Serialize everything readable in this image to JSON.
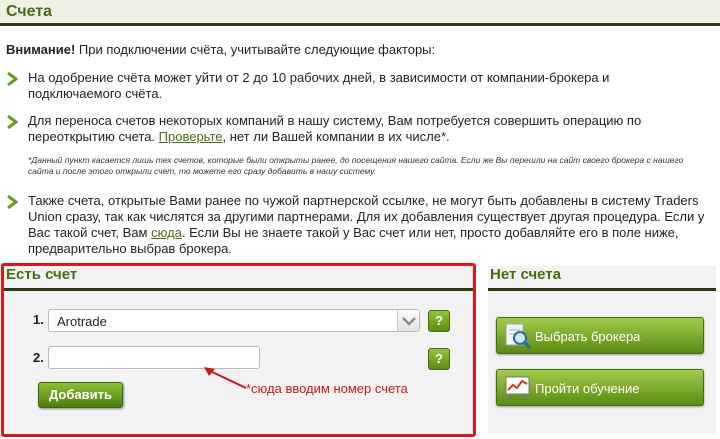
{
  "header": {
    "title": "Счета"
  },
  "warning": {
    "bold": "Внимание!",
    "text": " При подключении счёта, учитывайте следующие факторы:"
  },
  "bullets": [
    {
      "text": "На одобрение счёта может уйти от 2 до 10 рабочих дней, в зависимости от компании-брокера и подключаемого счёта."
    },
    {
      "text_before": "Для переноса счетов некоторых компаний в нашу систему, Вам потребуется совершить операцию по переоткрытию счета. ",
      "link": "Проверьте",
      "text_after": ", нет ли Вашей компании в их числе*."
    },
    {
      "text_before": "Также счета, открытые Вами ранее по чужой партнерской ссылке, не могут быть добавлены в систему Traders Union сразу, так как числятся за другими партнерами. Для их добавления существует другая процедура. Если у Вас такой счет, Вам ",
      "link": "сюда",
      "text_after": ". Если Вы не знаете такой у Вас счет или нет, просто добавляйте его в поле ниже, предварительно выбрав брокера."
    }
  ],
  "note": "*Данный пункт касается лишь тех счетов, которые были открыты ранее, до посещения нашего сайта. Если же Вы перешли на сайт своего брокера с нашего сайта и после этого открыли счет, то можете его сразу добавить в нашу систему.",
  "has_account": {
    "title": "Есть счет",
    "row1_num": "1.",
    "broker_selected": "Arotrade",
    "row2_num": "2.",
    "account_value": "",
    "help_label": "?",
    "add_button": "Добавить",
    "annotation": "*сюда вводим номер счета"
  },
  "no_account": {
    "title": "Нет счета",
    "choose_broker": "Выбрать брокера",
    "training": "Пройти обучение"
  },
  "colors": {
    "accent_green": "#4a6b12",
    "button_green": "#6b9a1c",
    "highlight_red": "#d41b1b",
    "dark_bar": "#2d3a10"
  }
}
